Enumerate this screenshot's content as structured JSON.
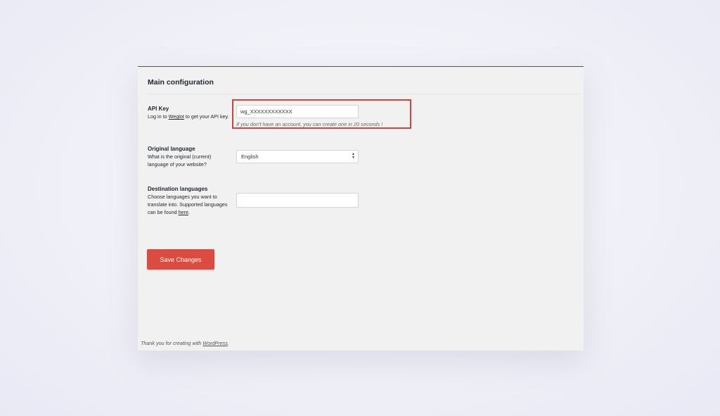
{
  "section": {
    "title": "Main configuration"
  },
  "api_key": {
    "label": "API Key",
    "desc_before": "Log in to ",
    "desc_link": "Weglot",
    "desc_after": " to get your API key.",
    "value": "wg_XXXXXXXXXXXX",
    "hint": "If you don't have an account, you can create one in 20 seconds !"
  },
  "original_language": {
    "label": "Original language",
    "desc": "What is the original (current) language of your website?",
    "selected": "English"
  },
  "destination_languages": {
    "label": "Destination languages",
    "desc_before": "Choose languages you want to translate into. Supported languages can be found ",
    "desc_link": "here",
    "desc_after": ".",
    "value": ""
  },
  "actions": {
    "save_label": "Save Changes"
  },
  "footer": {
    "text_before": "Thank you for creating with ",
    "link": "WordPress",
    "text_after": "."
  },
  "colors": {
    "accent": "#db4b3f",
    "highlight_border": "#d7423a",
    "panel_background": "#f1f1f1",
    "page_background": "#eeeef8"
  },
  "icons": {
    "select_arrows": "up-down-chevron-icon"
  }
}
